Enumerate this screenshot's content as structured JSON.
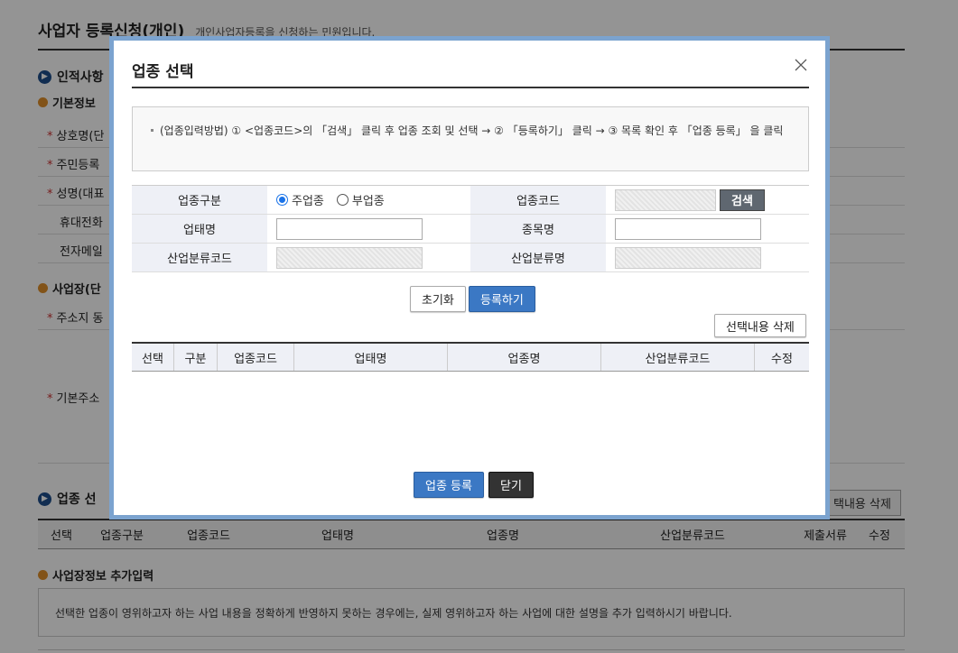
{
  "bg": {
    "page_title": "사업자 등록신청(개인)",
    "page_subtitle": "개인사업자등록을 신청하는 민원입니다.",
    "sec_personal": "인적사항",
    "sub_basic": "기본정보",
    "row_trade_name": "상호명(단",
    "row_rrn": "주민등록",
    "row_name": "성명(대표",
    "row_mobile": "휴대전화",
    "row_email": "전자메일",
    "sub_site": "사업장(단",
    "row_address": "주소지 동",
    "row_base_address": "기본주소",
    "sec_business": "업종 선",
    "delete_selected": "택내용 삭제",
    "table_headers": [
      "선택",
      "업종구분",
      "업종코드",
      "업태명",
      "업종명",
      "산업분류코드",
      "제출서류",
      "수정"
    ],
    "sub_extra": "사업장정보 추가입력",
    "notice": "선택한 업종이 영위하고자 하는 사업 내용을 정확하게 반영하지 못하는 경우에는, 실제 영위하고자 하는 사업에 대한 설명을 추가 입력하시기 바랍니다."
  },
  "modal": {
    "title": "업종 선택",
    "guide": "(업종입력방법) ① <업종코드>의 「검색」 클릭 후 업종 조회 및 선택 → ② 「등록하기」 클릭 → ③ 목록 확인 후 「업종 등록」 을 클릭",
    "form": {
      "type_label": "업종구분",
      "radio_main": "주업종",
      "radio_sub": "부업종",
      "code_label": "업종코드",
      "search_btn": "검색",
      "biz_type_label": "업태명",
      "biz_type_value": "",
      "item_label": "종목명",
      "item_value": "",
      "ind_code_label": "산업분류코드",
      "ind_name_label": "산업분류명"
    },
    "reset_btn": "초기화",
    "register_btn": "등록하기",
    "delete_selected_btn": "선택내용 삭제",
    "list_headers": [
      "선택",
      "구분",
      "업종코드",
      "업태명",
      "업종명",
      "산업분류코드",
      "수정"
    ],
    "submit_btn": "업종 등록",
    "close_btn": "닫기"
  }
}
